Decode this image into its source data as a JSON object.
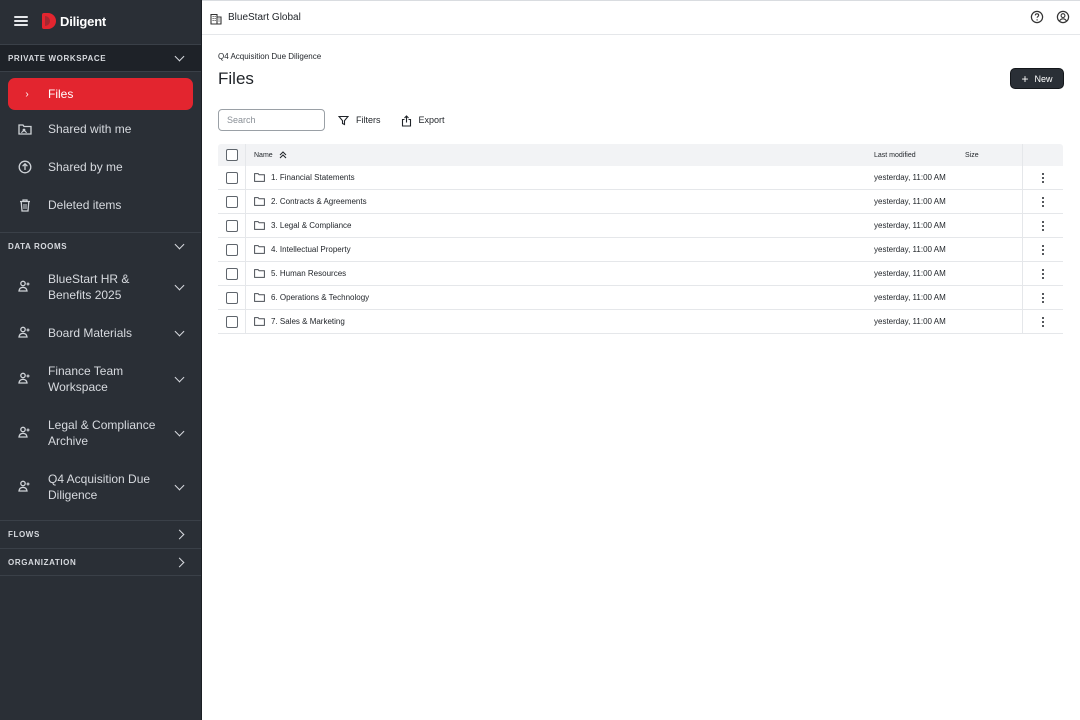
{
  "brand": {
    "name": "Diligent"
  },
  "sidebar": {
    "private_workspace": {
      "title": "PRIVATE WORKSPACE",
      "items": [
        {
          "label": "Files",
          "icon": "chevron-right-icon",
          "active": true
        },
        {
          "label": "Shared with me",
          "icon": "shared-folder-icon"
        },
        {
          "label": "Shared by me",
          "icon": "upload-icon"
        },
        {
          "label": "Deleted items",
          "icon": "trash-icon"
        }
      ]
    },
    "data_rooms": {
      "title": "DATA ROOMS",
      "items": [
        {
          "label": "BlueStart HR & Benefits 2025",
          "icon": "users-icon"
        },
        {
          "label": "Board Materials",
          "icon": "users-icon"
        },
        {
          "label": "Finance Team Workspace",
          "icon": "users-icon"
        },
        {
          "label": "Legal & Compliance Archive",
          "icon": "users-icon"
        },
        {
          "label": "Q4 Acquisition Due Diligence",
          "icon": "users-icon"
        }
      ]
    },
    "flows": {
      "title": "FLOWS"
    },
    "organization": {
      "title": "ORGANIZATION"
    }
  },
  "topbar": {
    "org_name": "BlueStart Global",
    "icons": [
      "building-icon",
      "help-icon",
      "account-icon"
    ]
  },
  "main": {
    "breadcrumb": "Q4 Acquisition Due Diligence",
    "title": "Files",
    "new_label": "New",
    "search_placeholder": "Search",
    "filters_label": "Filters",
    "export_label": "Export",
    "table": {
      "columns": {
        "name": "Name",
        "modified": "Last modified",
        "size": "Size"
      },
      "rows": [
        {
          "name": "1. Financial Statements",
          "modified": "yesterday, 11:00 AM",
          "size": ""
        },
        {
          "name": "2. Contracts & Agreements",
          "modified": "yesterday, 11:00 AM",
          "size": ""
        },
        {
          "name": "3. Legal & Compliance",
          "modified": "yesterday, 11:00 AM",
          "size": ""
        },
        {
          "name": "4. Intellectual Property",
          "modified": "yesterday, 11:00 AM",
          "size": ""
        },
        {
          "name": "5. Human Resources",
          "modified": "yesterday, 11:00 AM",
          "size": ""
        },
        {
          "name": "6. Operations & Technology",
          "modified": "yesterday, 11:00 AM",
          "size": ""
        },
        {
          "name": "7. Sales & Marketing",
          "modified": "yesterday, 11:00 AM",
          "size": ""
        }
      ]
    }
  },
  "colors": {
    "accent": "#e3252f",
    "sidebar_bg": "#2a2f36"
  }
}
